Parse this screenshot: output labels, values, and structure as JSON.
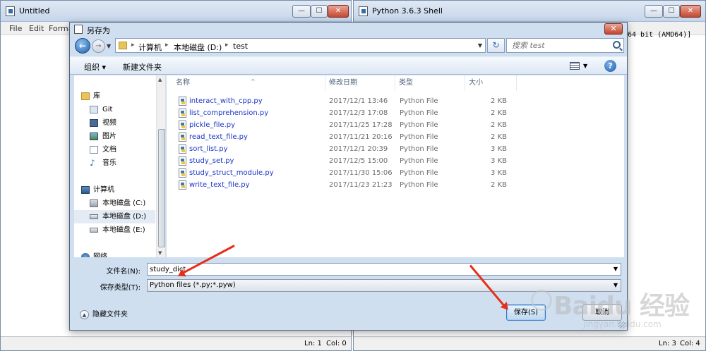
{
  "left_window": {
    "title": "Untitled",
    "menu": [
      "File",
      "Edit",
      "Forma"
    ],
    "status": {
      "ln": "Ln: 1",
      "col": "Col: 0"
    },
    "controls": {
      "minimize": "—",
      "maximize": "☐",
      "close": "✕"
    }
  },
  "right_window": {
    "title": "Python 3.6.3 Shell",
    "content_line": "64 bit (AMD64)]",
    "status": {
      "ln": "Ln: 3",
      "col": "Col: 4"
    },
    "controls": {
      "minimize": "—",
      "maximize": "☐",
      "close": "✕"
    }
  },
  "dialog": {
    "title": "另存为",
    "close_label": "✕",
    "address": [
      "计算机",
      "本地磁盘 (D:)",
      "test"
    ],
    "search_placeholder": "搜索 test",
    "toolbar": {
      "organize": "组织 ▾",
      "new_folder": "新建文件夹",
      "help": "?"
    },
    "nav": {
      "libraries": "库",
      "git": "Git",
      "video": "视频",
      "pictures": "图片",
      "documents": "文档",
      "music": "音乐",
      "computer": "计算机",
      "drive_c": "本地磁盘 (C:)",
      "drive_d": "本地磁盘 (D:)",
      "drive_e": "本地磁盘 (E:)",
      "network": "网络"
    },
    "columns": {
      "name": "名称",
      "date": "修改日期",
      "type": "类型",
      "size": "大小"
    },
    "files": [
      {
        "name": "interact_with_cpp.py",
        "date": "2017/12/1 13:46",
        "type": "Python File",
        "size": "2 KB"
      },
      {
        "name": "list_comprehension.py",
        "date": "2017/12/3 17:08",
        "type": "Python File",
        "size": "2 KB"
      },
      {
        "name": "pickle_file.py",
        "date": "2017/11/25 17:28",
        "type": "Python File",
        "size": "2 KB"
      },
      {
        "name": "read_text_file.py",
        "date": "2017/11/21 20:16",
        "type": "Python File",
        "size": "2 KB"
      },
      {
        "name": "sort_list.py",
        "date": "2017/12/1 20:39",
        "type": "Python File",
        "size": "3 KB"
      },
      {
        "name": "study_set.py",
        "date": "2017/12/5 15:00",
        "type": "Python File",
        "size": "3 KB"
      },
      {
        "name": "study_struct_module.py",
        "date": "2017/11/30 15:06",
        "type": "Python File",
        "size": "3 KB"
      },
      {
        "name": "write_text_file.py",
        "date": "2017/11/23 21:23",
        "type": "Python File",
        "size": "2 KB"
      }
    ],
    "filename_label": "文件名(N):",
    "filename_value": "study_dict",
    "filetype_label": "保存类型(T):",
    "filetype_value": "Python files (*.py;*.pyw)",
    "hide_folders": "隐藏文件夹",
    "save_button": "保存(S)",
    "cancel_button": "取消"
  },
  "watermark": {
    "brand": "Baidu 经验",
    "url": "jingyan.baidu.com"
  },
  "colors": {
    "arrow": "#e62e1a",
    "link": "#1a37c8",
    "dialog_frame": "#cfdff0"
  }
}
